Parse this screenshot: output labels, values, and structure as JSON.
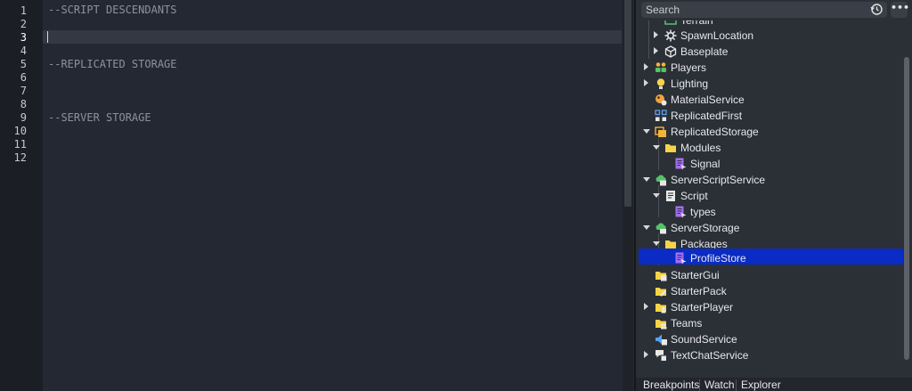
{
  "editor": {
    "line_numbers": [
      "1",
      "2",
      "3",
      "4",
      "5",
      "6",
      "7",
      "8",
      "9",
      "10",
      "11",
      "12"
    ],
    "active_line": "3",
    "lines": [
      "--SCRIPT DESCENDANTS",
      "",
      "",
      "--REPLICATED STORAGE",
      "",
      "",
      "",
      "--SERVER STORAGE",
      "",
      "",
      "",
      ""
    ]
  },
  "explorer": {
    "search_placeholder": "Search",
    "more_label": "•••",
    "items": [
      {
        "label": "Terrain",
        "icon": "terrain-icon"
      },
      {
        "label": "SpawnLocation",
        "icon": "spawn-icon"
      },
      {
        "label": "Baseplate",
        "icon": "part-icon"
      },
      {
        "label": "Players",
        "icon": "players-icon"
      },
      {
        "label": "Lighting",
        "icon": "lighting-icon"
      },
      {
        "label": "MaterialService",
        "icon": "material-service-icon"
      },
      {
        "label": "ReplicatedFirst",
        "icon": "replicated-first-icon"
      },
      {
        "label": "ReplicatedStorage",
        "icon": "replicated-storage-icon"
      },
      {
        "label": "Modules",
        "icon": "folder-icon"
      },
      {
        "label": "Signal",
        "icon": "module-script-icon"
      },
      {
        "label": "ServerScriptService",
        "icon": "server-script-service-icon"
      },
      {
        "label": "Script",
        "icon": "script-icon"
      },
      {
        "label": "types",
        "icon": "module-script-icon"
      },
      {
        "label": "ServerStorage",
        "icon": "server-storage-icon"
      },
      {
        "label": "Packages",
        "icon": "folder-icon"
      },
      {
        "label": "ProfileStore",
        "icon": "module-script-icon"
      },
      {
        "label": "StarterGui",
        "icon": "starter-gui-icon"
      },
      {
        "label": "StarterPack",
        "icon": "starter-pack-icon"
      },
      {
        "label": "StarterPlayer",
        "icon": "starter-player-icon"
      },
      {
        "label": "Teams",
        "icon": "teams-icon"
      },
      {
        "label": "SoundService",
        "icon": "sound-service-icon"
      },
      {
        "label": "TextChatService",
        "icon": "text-chat-service-icon"
      }
    ]
  },
  "bottom_tabs": [
    "Breakpoints",
    "Watch",
    "Explorer"
  ],
  "colors": {
    "selection": "#0a2bc4",
    "editor_bg": "#242832",
    "panel_bg": "#2b2f36"
  }
}
